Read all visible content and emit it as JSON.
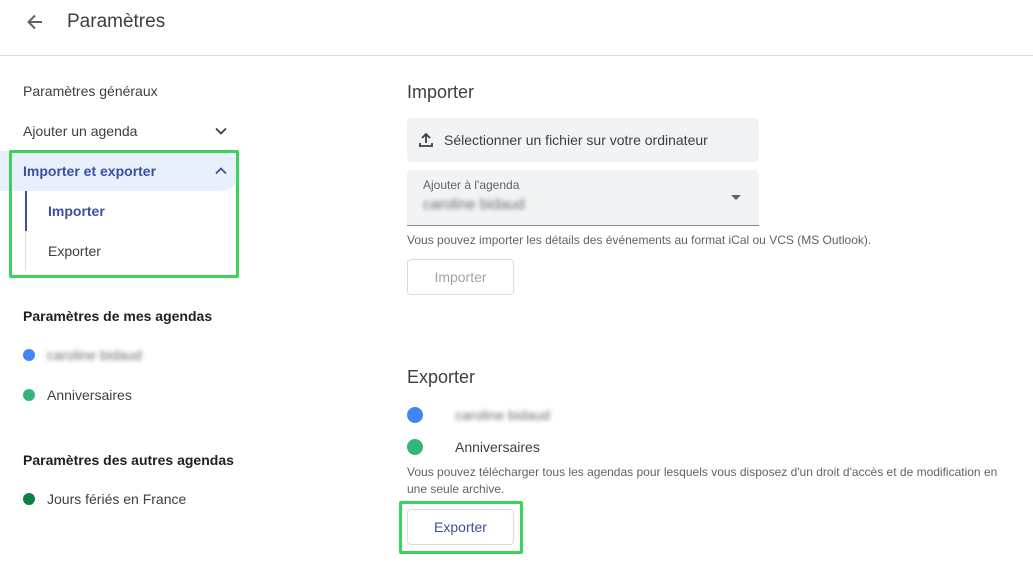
{
  "header": {
    "title": "Paramètres"
  },
  "sidebar": {
    "general": "Paramètres généraux",
    "add_calendar": "Ajouter un agenda",
    "import_export": "Importer et exporter",
    "sub_import": "Importer",
    "sub_export": "Exporter",
    "my_calendars_label": "Paramètres de mes agendas",
    "my_calendars": [
      {
        "name": "caroline bidaud",
        "color": "#4285f4"
      },
      {
        "name": "Anniversaires",
        "color": "#33b679"
      }
    ],
    "other_calendars_label": "Paramètres des autres agendas",
    "other_calendars": [
      {
        "name": "Jours fériés en France",
        "color": "#0b8043"
      }
    ]
  },
  "import": {
    "title": "Importer",
    "file_button": "Sélectionner un fichier sur votre ordinateur",
    "select_label": "Ajouter à l'agenda",
    "select_value": "caroline bidaud",
    "help": "Vous pouvez importer les détails des événements au format iCal ou VCS (MS Outlook).",
    "button": "Importer"
  },
  "export": {
    "title": "Exporter",
    "items": [
      {
        "name": "caroline bidaud",
        "color": "#4285f4"
      },
      {
        "name": "Anniversaires",
        "color": "#33b679"
      }
    ],
    "help": "Vous pouvez télécharger tous les agendas pour lesquels vous disposez d'un droit d'accès et de modification en une seule archive.",
    "button": "Exporter"
  },
  "colors": {
    "accent": "#3c4fa1",
    "highlight": "#3cd35b"
  }
}
